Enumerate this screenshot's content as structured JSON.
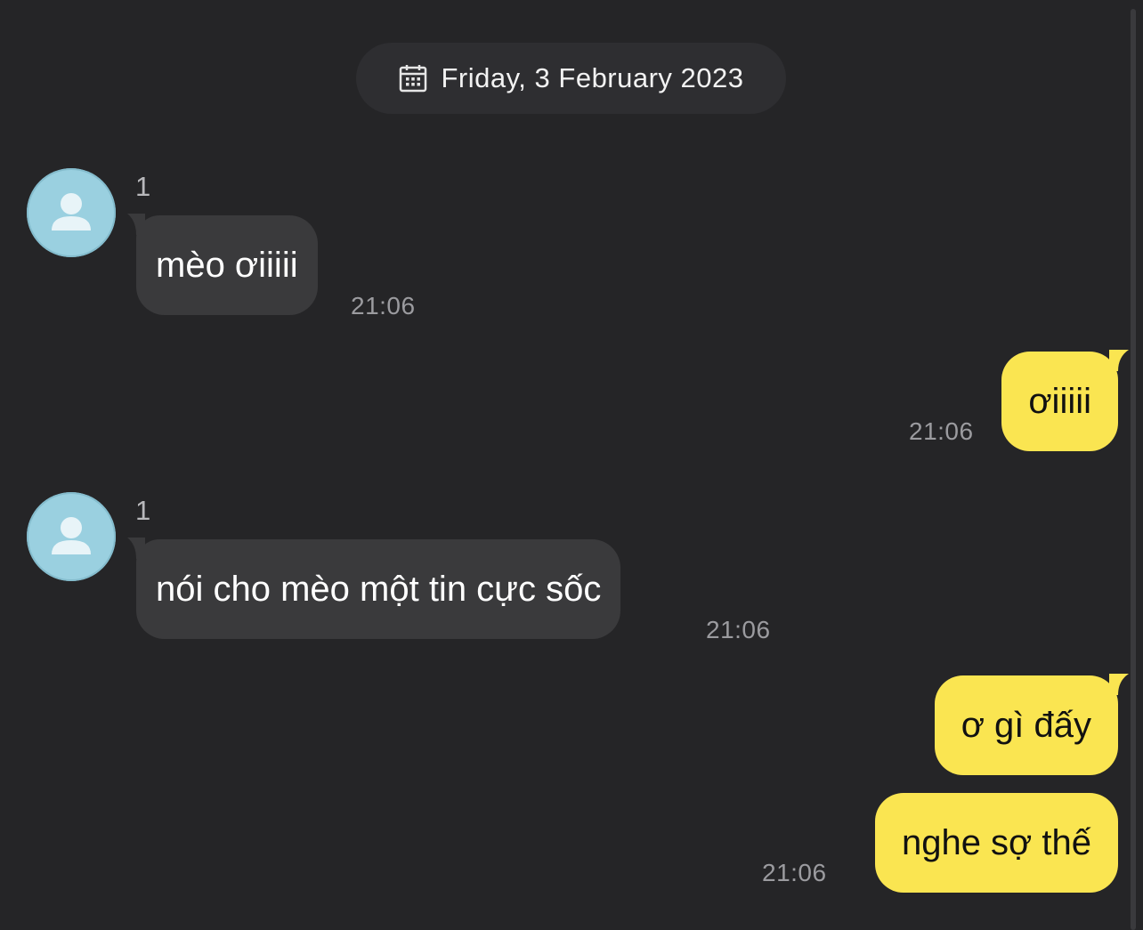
{
  "conversation": {
    "date_label": "Friday, 3 February 2023",
    "messages": [
      {
        "direction": "incoming",
        "sender": "1",
        "text": "mèo ơiiiii",
        "time": "21:06"
      },
      {
        "direction": "outgoing",
        "text": "ơiiiii",
        "time": "21:06"
      },
      {
        "direction": "incoming",
        "sender": "1",
        "text": "nói cho mèo một tin cực sốc",
        "time": "21:06"
      },
      {
        "direction": "outgoing",
        "text": "ơ gì đấy",
        "time": ""
      },
      {
        "direction": "outgoing",
        "text": "nghe sợ thế",
        "time": "21:06"
      }
    ]
  },
  "icons": {
    "date": "calendar-icon",
    "avatar": "default-user-avatar-icon"
  },
  "colors": {
    "background": "#252527",
    "incoming_bubble": "#3a3a3c",
    "outgoing_bubble": "#fae551",
    "avatar": "#9ad0e0"
  }
}
